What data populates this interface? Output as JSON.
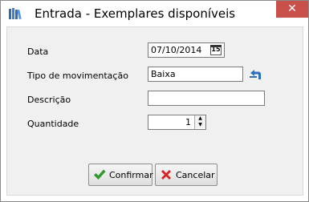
{
  "window": {
    "title": "Entrada - Exemplares disponíveis",
    "close_glyph": "✕"
  },
  "form": {
    "data_label": "Data",
    "data_value": "07/10/2014",
    "calendar_glyph": "15",
    "tipo_label": "Tipo de movimentação",
    "tipo_value": "Baixa",
    "descricao_label": "Descrição",
    "descricao_value": "",
    "quantidade_label": "Quantidade",
    "quantidade_value": "1",
    "spin_up_glyph": "▲",
    "spin_down_glyph": "▼"
  },
  "buttons": {
    "confirm_label": "Confirmar",
    "cancel_label": "Cancelar"
  },
  "icons": {
    "app": "books-icon",
    "tipo_action": "undo-arrow-icon",
    "confirm": "checkmark-icon",
    "cancel": "x-icon"
  },
  "colors": {
    "close_button": "#c7504b",
    "confirm_icon": "#2e9a2e",
    "cancel_icon": "#d62222",
    "undo_icon": "#2f6fb5",
    "app_icon": "#2c6db5"
  }
}
